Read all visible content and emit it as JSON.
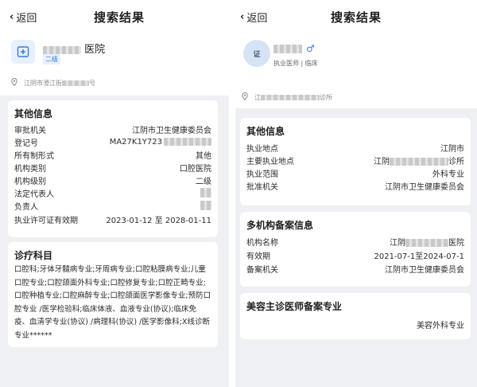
{
  "left": {
    "header": {
      "back_label": "返回",
      "title": "搜索结果"
    },
    "org": {
      "name_suffix": "医院",
      "badge": "二级",
      "address_prefix": "江阴市澄江街",
      "address_suffix": "号"
    },
    "other_info": {
      "title": "其他信息",
      "rows": [
        {
          "label": "审批机关",
          "value": "江阴市卫生健康委员会"
        },
        {
          "label": "登记号",
          "value": "MA27K1Y723"
        },
        {
          "label": "所有制形式",
          "value": "其他"
        },
        {
          "label": "机构类别",
          "value": "口腔医院"
        },
        {
          "label": "机构级别",
          "value": "二级"
        },
        {
          "label": "法定代表人",
          "value": ""
        },
        {
          "label": "负责人",
          "value": ""
        },
        {
          "label": "执业许可证有效期",
          "value": "2023-01-12 至 2028-01-11"
        }
      ]
    },
    "subjects": {
      "title": "诊疗科目",
      "text": "口腔科;牙体牙髓病专业;牙周病专业;口腔粘膜病专业;儿童口腔专业;口腔颌面外科专业;口腔修复专业;口腔正畸专业;口腔种植专业;口腔麻醉专业;口腔颌面医学影像专业;预防口腔专业 /医学检验科;临床体液、血液专业(协议);临床免疫、血清学专业(协议) /病理科(协议) /医学影像科;X线诊断专业******"
    }
  },
  "right": {
    "header": {
      "back_label": "返回",
      "title": "搜索结果"
    },
    "doctor": {
      "avatar_text": "证",
      "gender": "♂",
      "role": "执业医师 | 临床",
      "address_prefix": "江",
      "address_suffix": "诊所"
    },
    "other_info": {
      "title": "其他信息",
      "rows": [
        {
          "label": "执业地点",
          "value": "江阴市"
        },
        {
          "label": "主要执业地点",
          "value": "江阴",
          "value_suffix": "诊所"
        },
        {
          "label": "执业范围",
          "value": "外科专业"
        },
        {
          "label": "批准机关",
          "value": "江阴市卫生健康委员会"
        }
      ]
    },
    "multi": {
      "title": "多机构备案信息",
      "rows": [
        {
          "label": "机构名称",
          "value": "江阴",
          "value_suffix": "医院"
        },
        {
          "label": "有效期",
          "value": "2021-07-1至2024-07-1"
        },
        {
          "label": "备案机关",
          "value": "江阴市卫生健康委员会"
        }
      ]
    },
    "beauty": {
      "title": "美容主诊医师备案专业",
      "value": "美容外科专业"
    }
  },
  "colors": {
    "accent": "#3a7be0",
    "page_bg": "#eef0f4",
    "card_bg": "#ffffff"
  }
}
